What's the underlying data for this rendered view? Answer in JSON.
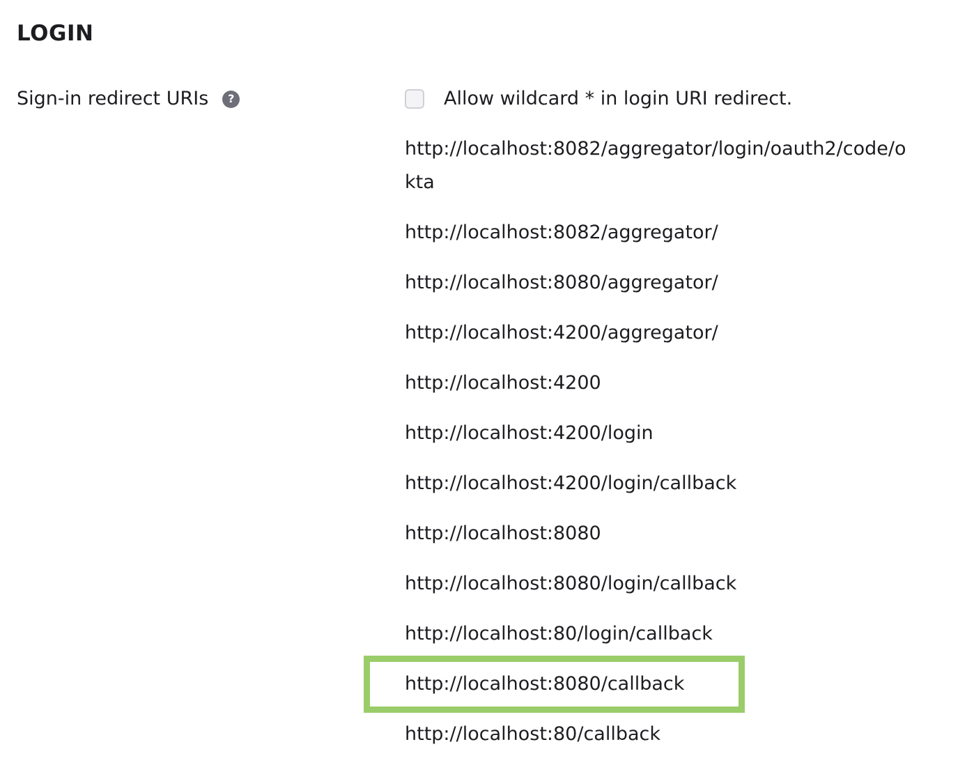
{
  "section": {
    "title": "LOGIN"
  },
  "field": {
    "label": "Sign-in redirect URIs",
    "help_icon": "question-circle-icon",
    "help_glyph": "?"
  },
  "wildcard": {
    "checked": false,
    "label": "Allow wildcard * in login URI redirect."
  },
  "redirect_uris": [
    "http://localhost:8082/aggregator/login/oauth2/code/okta",
    "http://localhost:8082/aggregator/",
    "http://localhost:8080/aggregator/",
    "http://localhost:4200/aggregator/",
    "http://localhost:4200",
    "http://localhost:4200/login",
    "http://localhost:4200/login/callback",
    "http://localhost:8080",
    "http://localhost:8080/login/callback",
    "http://localhost:80/login/callback",
    "http://localhost:8080/callback",
    "http://localhost:80/callback"
  ],
  "highlight": {
    "color": "#9acd6a",
    "target_uri": "http://localhost:8080/callback"
  }
}
